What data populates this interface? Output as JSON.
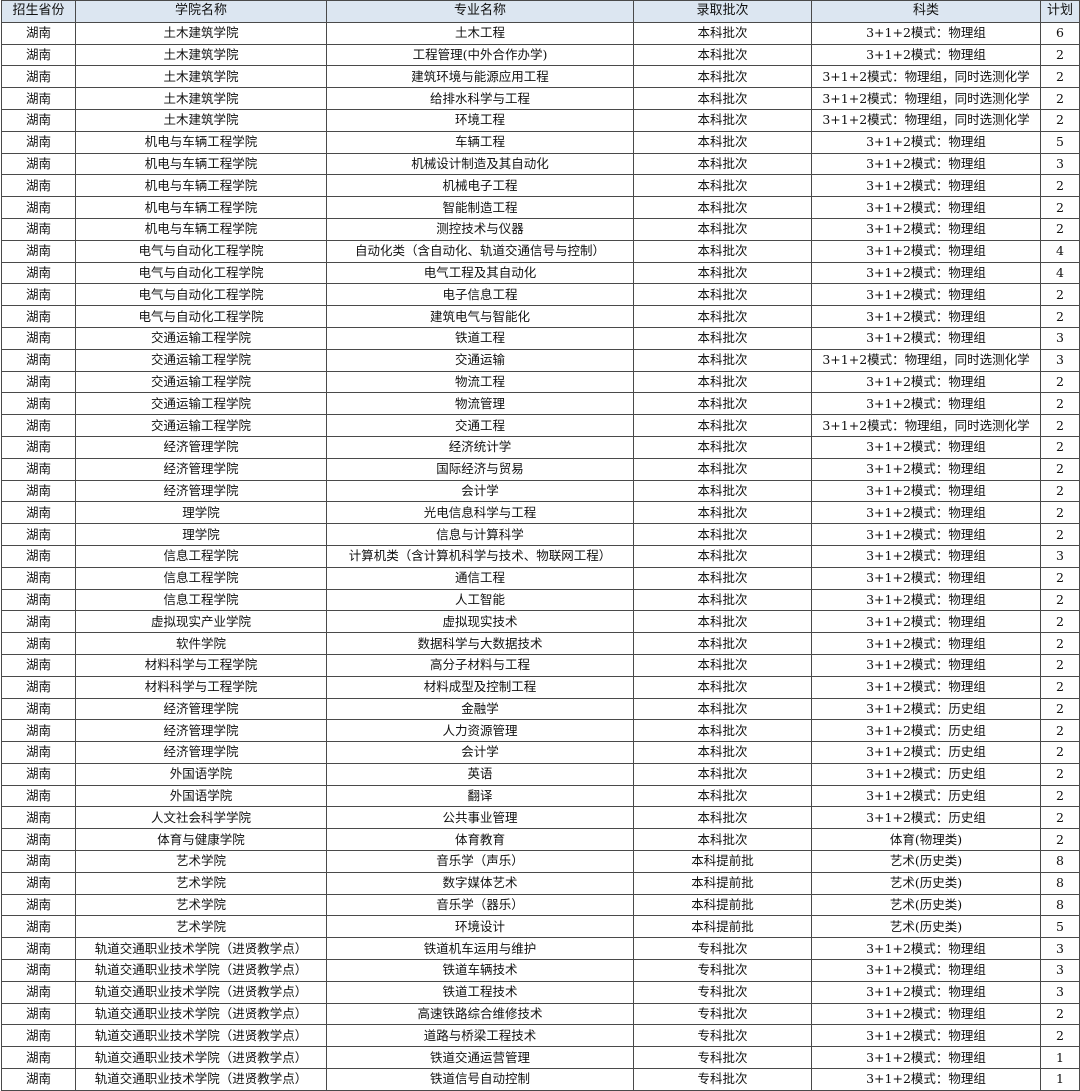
{
  "header": [
    "招生省份",
    "学院名称",
    "专业名称",
    "录取批次",
    "科类",
    "计划"
  ],
  "rows": [
    [
      "湖南",
      "土木建筑学院",
      "土木工程",
      "本科批次",
      "3+1+2模式：物理组",
      "6"
    ],
    [
      "湖南",
      "土木建筑学院",
      "工程管理(中外合作办学)",
      "本科批次",
      "3+1+2模式：物理组",
      "2"
    ],
    [
      "湖南",
      "土木建筑学院",
      "建筑环境与能源应用工程",
      "本科批次",
      "3+1+2模式：物理组，同时选测化学",
      "2"
    ],
    [
      "湖南",
      "土木建筑学院",
      "给排水科学与工程",
      "本科批次",
      "3+1+2模式：物理组，同时选测化学",
      "2"
    ],
    [
      "湖南",
      "土木建筑学院",
      "环境工程",
      "本科批次",
      "3+1+2模式：物理组，同时选测化学",
      "2"
    ],
    [
      "湖南",
      "机电与车辆工程学院",
      "车辆工程",
      "本科批次",
      "3+1+2模式：物理组",
      "5"
    ],
    [
      "湖南",
      "机电与车辆工程学院",
      "机械设计制造及其自动化",
      "本科批次",
      "3+1+2模式：物理组",
      "3"
    ],
    [
      "湖南",
      "机电与车辆工程学院",
      "机械电子工程",
      "本科批次",
      "3+1+2模式：物理组",
      "2"
    ],
    [
      "湖南",
      "机电与车辆工程学院",
      "智能制造工程",
      "本科批次",
      "3+1+2模式：物理组",
      "2"
    ],
    [
      "湖南",
      "机电与车辆工程学院",
      "测控技术与仪器",
      "本科批次",
      "3+1+2模式：物理组",
      "2"
    ],
    [
      "湖南",
      "电气与自动化工程学院",
      "自动化类（含自动化、轨道交通信号与控制）",
      "本科批次",
      "3+1+2模式：物理组",
      "4"
    ],
    [
      "湖南",
      "电气与自动化工程学院",
      "电气工程及其自动化",
      "本科批次",
      "3+1+2模式：物理组",
      "4"
    ],
    [
      "湖南",
      "电气与自动化工程学院",
      "电子信息工程",
      "本科批次",
      "3+1+2模式：物理组",
      "2"
    ],
    [
      "湖南",
      "电气与自动化工程学院",
      "建筑电气与智能化",
      "本科批次",
      "3+1+2模式：物理组",
      "2"
    ],
    [
      "湖南",
      "交通运输工程学院",
      "铁道工程",
      "本科批次",
      "3+1+2模式：物理组",
      "3"
    ],
    [
      "湖南",
      "交通运输工程学院",
      "交通运输",
      "本科批次",
      "3+1+2模式：物理组，同时选测化学",
      "3"
    ],
    [
      "湖南",
      "交通运输工程学院",
      "物流工程",
      "本科批次",
      "3+1+2模式：物理组",
      "2"
    ],
    [
      "湖南",
      "交通运输工程学院",
      "物流管理",
      "本科批次",
      "3+1+2模式：物理组",
      "2"
    ],
    [
      "湖南",
      "交通运输工程学院",
      "交通工程",
      "本科批次",
      "3+1+2模式：物理组，同时选测化学",
      "2"
    ],
    [
      "湖南",
      "经济管理学院",
      "经济统计学",
      "本科批次",
      "3+1+2模式：物理组",
      "2"
    ],
    [
      "湖南",
      "经济管理学院",
      "国际经济与贸易",
      "本科批次",
      "3+1+2模式：物理组",
      "2"
    ],
    [
      "湖南",
      "经济管理学院",
      "会计学",
      "本科批次",
      "3+1+2模式：物理组",
      "2"
    ],
    [
      "湖南",
      "理学院",
      "光电信息科学与工程",
      "本科批次",
      "3+1+2模式：物理组",
      "2"
    ],
    [
      "湖南",
      "理学院",
      "信息与计算科学",
      "本科批次",
      "3+1+2模式：物理组",
      "2"
    ],
    [
      "湖南",
      "信息工程学院",
      "计算机类（含计算机科学与技术、物联网工程）",
      "本科批次",
      "3+1+2模式：物理组",
      "3"
    ],
    [
      "湖南",
      "信息工程学院",
      "通信工程",
      "本科批次",
      "3+1+2模式：物理组",
      "2"
    ],
    [
      "湖南",
      "信息工程学院",
      "人工智能",
      "本科批次",
      "3+1+2模式：物理组",
      "2"
    ],
    [
      "湖南",
      "虚拟现实产业学院",
      "虚拟现实技术",
      "本科批次",
      "3+1+2模式：物理组",
      "2"
    ],
    [
      "湖南",
      "软件学院",
      "数据科学与大数据技术",
      "本科批次",
      "3+1+2模式：物理组",
      "2"
    ],
    [
      "湖南",
      "材料科学与工程学院",
      "高分子材料与工程",
      "本科批次",
      "3+1+2模式：物理组",
      "2"
    ],
    [
      "湖南",
      "材料科学与工程学院",
      "材料成型及控制工程",
      "本科批次",
      "3+1+2模式：物理组",
      "2"
    ],
    [
      "湖南",
      "经济管理学院",
      "金融学",
      "本科批次",
      "3+1+2模式：历史组",
      "2"
    ],
    [
      "湖南",
      "经济管理学院",
      "人力资源管理",
      "本科批次",
      "3+1+2模式：历史组",
      "2"
    ],
    [
      "湖南",
      "经济管理学院",
      "会计学",
      "本科批次",
      "3+1+2模式：历史组",
      "2"
    ],
    [
      "湖南",
      "外国语学院",
      "英语",
      "本科批次",
      "3+1+2模式：历史组",
      "2"
    ],
    [
      "湖南",
      "外国语学院",
      "翻译",
      "本科批次",
      "3+1+2模式：历史组",
      "2"
    ],
    [
      "湖南",
      "人文社会科学学院",
      "公共事业管理",
      "本科批次",
      "3+1+2模式：历史组",
      "2"
    ],
    [
      "湖南",
      "体育与健康学院",
      "体育教育",
      "本科批次",
      "体育(物理类)",
      "2"
    ],
    [
      "湖南",
      "艺术学院",
      "音乐学（声乐）",
      "本科提前批",
      "艺术(历史类)",
      "8"
    ],
    [
      "湖南",
      "艺术学院",
      "数字媒体艺术",
      "本科提前批",
      "艺术(历史类)",
      "8"
    ],
    [
      "湖南",
      "艺术学院",
      "音乐学（器乐）",
      "本科提前批",
      "艺术(历史类)",
      "8"
    ],
    [
      "湖南",
      "艺术学院",
      "环境设计",
      "本科提前批",
      "艺术(历史类)",
      "5"
    ],
    [
      "湖南",
      "轨道交通职业技术学院（进贤教学点）",
      "铁道机车运用与维护",
      "专科批次",
      "3+1+2模式：物理组",
      "3"
    ],
    [
      "湖南",
      "轨道交通职业技术学院（进贤教学点）",
      "铁道车辆技术",
      "专科批次",
      "3+1+2模式：物理组",
      "3"
    ],
    [
      "湖南",
      "轨道交通职业技术学院（进贤教学点）",
      "铁道工程技术",
      "专科批次",
      "3+1+2模式：物理组",
      "3"
    ],
    [
      "湖南",
      "轨道交通职业技术学院（进贤教学点）",
      "高速铁路综合维修技术",
      "专科批次",
      "3+1+2模式：物理组",
      "2"
    ],
    [
      "湖南",
      "轨道交通职业技术学院（进贤教学点）",
      "道路与桥梁工程技术",
      "专科批次",
      "3+1+2模式：物理组",
      "2"
    ],
    [
      "湖南",
      "轨道交通职业技术学院（进贤教学点）",
      "铁道交通运营管理",
      "专科批次",
      "3+1+2模式：物理组",
      "1"
    ],
    [
      "湖南",
      "轨道交通职业技术学院（进贤教学点）",
      "铁道信号自动控制",
      "专科批次",
      "3+1+2模式：物理组",
      "1"
    ]
  ]
}
